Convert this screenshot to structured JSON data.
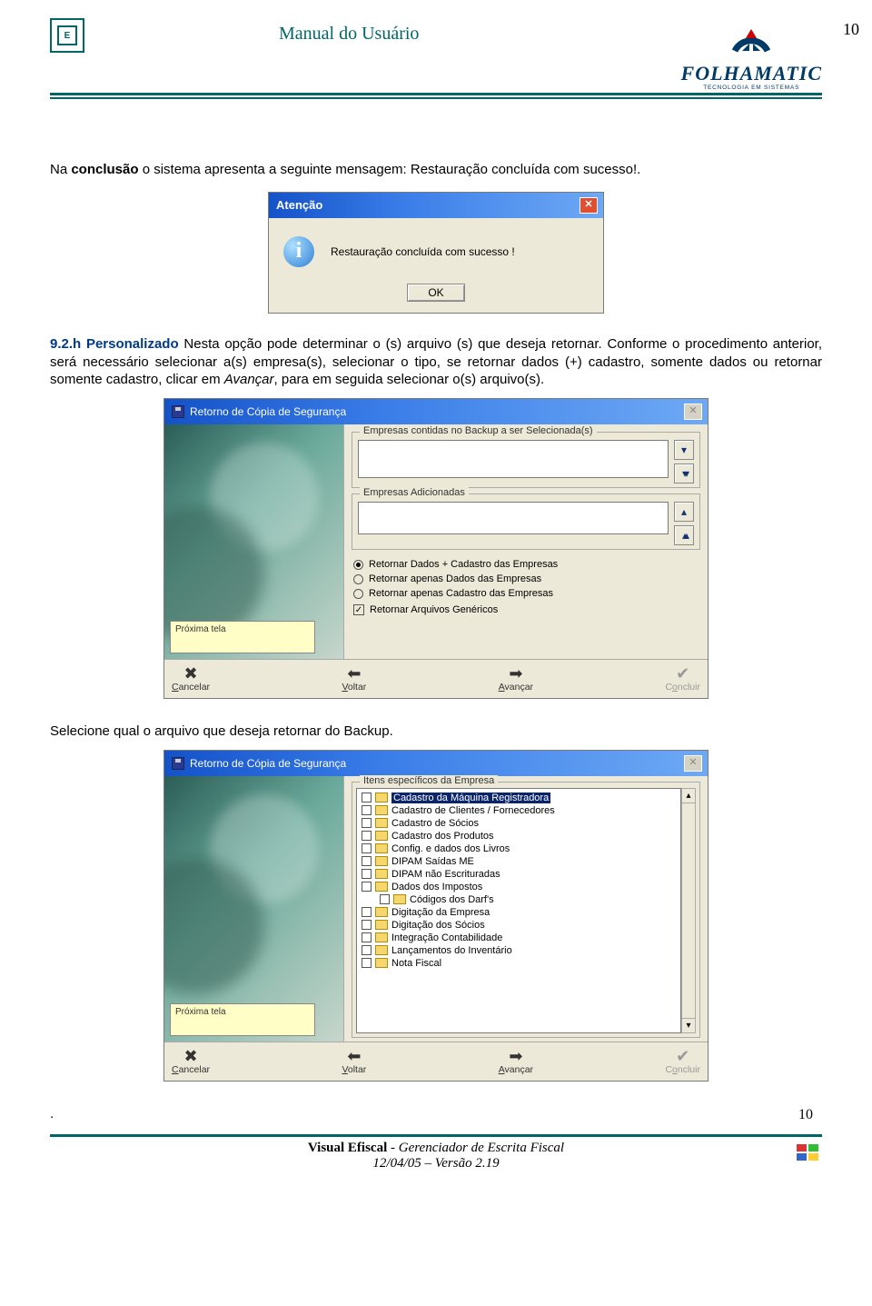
{
  "header": {
    "title": "Manual do Usuário",
    "brand_name": "FOLHAMATIC",
    "brand_tag": "TECNOLOGIA EM SISTEMAS",
    "page_top": "10"
  },
  "para1_a": "Na ",
  "para1_b": "conclusão",
  "para1_c": " o sistema apresenta a seguinte mensagem: Restauração concluída com sucesso!.",
  "dialog1": {
    "title": "Atenção",
    "msg": "Restauração concluída com sucesso !",
    "ok": "OK"
  },
  "sec": {
    "head": "9.2.h Personalizado",
    "body": " Nesta opção pode determinar o (s) arquivo (s) que deseja retornar. Conforme o procedimento anterior, será necessário selecionar a(s) empresa(s), selecionar o tipo, se retornar dados (+) cadastro, somente dados ou retornar somente cadastro, clicar em ",
    "avancar": "Avançar",
    "tail": ", para em seguida selecionar o(s) arquivo(s)."
  },
  "wiz": {
    "title": "Retorno de Cópia de Segurança",
    "gb1": "Empresas contidas no Backup a ser Selecionada(s)",
    "gb2": "Empresas Adicionadas",
    "prox": "Próxima tela",
    "r1": "Retornar Dados + Cadastro das Empresas",
    "r2": "Retornar apenas Dados das Empresas",
    "r3": "Retornar apenas Cadastro das Empresas",
    "chk": "Retornar Arquivos Genéricos",
    "btn_cancel": "Cancelar",
    "btn_back": "Voltar",
    "btn_next": "Avançar",
    "btn_done": "Concluir"
  },
  "para2": "Selecione qual o arquivo que deseja retornar do Backup.",
  "wiz2": {
    "title": "Retorno de Cópia de Segurança",
    "gb": "Itens específicos da Empresa",
    "prox": "Próxima tela",
    "items": [
      "Cadastro da Máquina Registradora",
      "Cadastro de Clientes / Fornecedores",
      "Cadastro de Sócios",
      "Cadastro dos Produtos",
      "Config. e dados dos Livros",
      "DIPAM Saídas ME",
      "DIPAM não Escrituradas",
      "Dados dos Impostos",
      "Códigos dos Darf's",
      "Digitação da Empresa",
      "Digitação dos Sócios",
      "Integração Contabilidade",
      "Lançamentos do Inventário",
      "Nota Fiscal"
    ],
    "btn_cancel": "Cancelar",
    "btn_back": "Voltar",
    "btn_next": "Avançar",
    "btn_done": "Concluir"
  },
  "footer": {
    "line1a": "Visual Efiscal",
    "line1b": " - Gerenciador de Escrita Fiscal",
    "line2": "12/04/05 – Versão 2.19",
    "page": "10"
  },
  "dot": "."
}
